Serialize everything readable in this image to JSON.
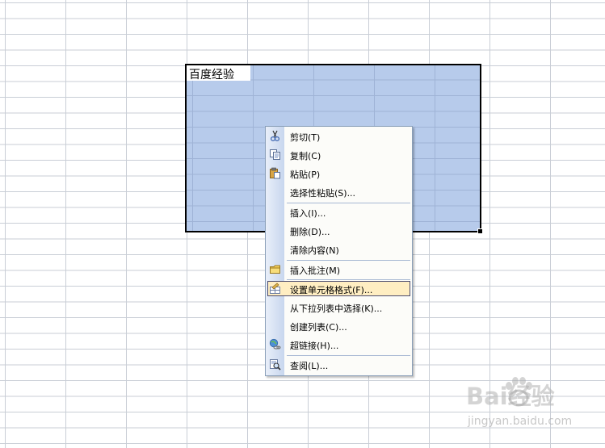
{
  "sheet": {
    "active_cell_text": "百度经验"
  },
  "context_menu": {
    "items": [
      {
        "label": "剪切(T)",
        "icon": "scissors-icon"
      },
      {
        "label": "复制(C)",
        "icon": "copy-icon"
      },
      {
        "label": "粘贴(P)",
        "icon": "paste-icon"
      },
      {
        "label": "选择性粘贴(S)..."
      },
      {
        "label": "插入(I)..."
      },
      {
        "label": "删除(D)..."
      },
      {
        "label": "清除内容(N)"
      },
      {
        "label": "插入批注(M)",
        "icon": "insert-comment-icon"
      },
      {
        "label": "设置单元格格式(F)...",
        "icon": "format-cells-icon",
        "highlighted": true
      },
      {
        "label": "从下拉列表中选择(K)..."
      },
      {
        "label": "创建列表(C)..."
      },
      {
        "label": "超链接(H)...",
        "icon": "hyperlink-icon"
      },
      {
        "label": "查阅(L)...",
        "icon": "research-icon"
      }
    ]
  },
  "watermark": {
    "brand": "Bai经验",
    "url": "jingyan.baidu.com"
  },
  "colors": {
    "selection_fill": "#b7cbeb",
    "menu_highlight": "#ffeec2",
    "menu_icon_strip": "#c7d6ee"
  }
}
